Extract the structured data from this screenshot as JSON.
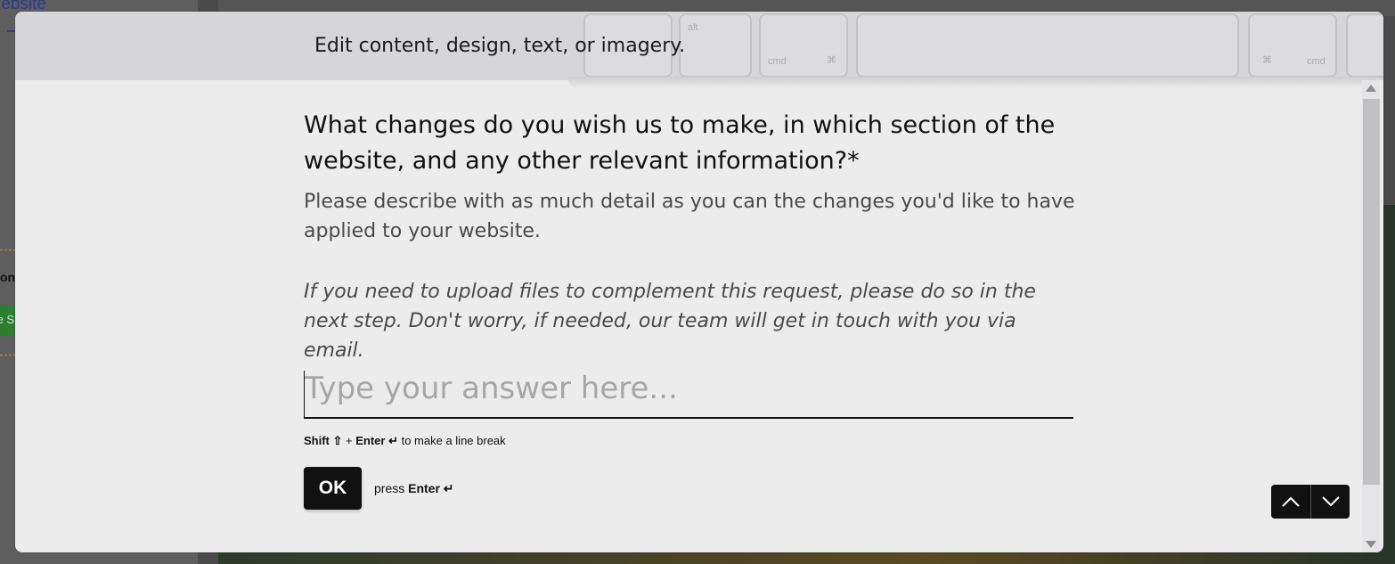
{
  "background": {
    "left_title": "/ebsite",
    "left_label": "on",
    "green_label": "e S"
  },
  "header": {
    "title": "Edit content, design, text, or imagery.",
    "key_labels": [
      "alt",
      "cmd",
      "cmd"
    ],
    "key_symbols": [
      "⌘",
      "⌘"
    ]
  },
  "question": {
    "title": "What changes do you wish us to make, in which section of the website, and any other relevant information?*",
    "description": "Please describe with as much detail as you can the changes you'd like to have applied to your website.",
    "note": "If you need to upload files to complement this request, please do so in the next step. Don't worry, if needed, our team will get in touch with you via email."
  },
  "answer": {
    "value": "",
    "placeholder": "Type your answer here..."
  },
  "hint": {
    "shift": "Shift ⇧",
    "plus": "+",
    "enter": "Enter ↵",
    "suffix": "to make a line break"
  },
  "ok": {
    "label": "OK",
    "press": "press",
    "enter": "Enter ↵"
  },
  "colors": {
    "accent": "#111111",
    "modal_bg": "#ececed",
    "placeholder": "#a6a6a8"
  },
  "icons": {
    "prev": "chevron-up-icon",
    "next": "chevron-down-icon"
  }
}
